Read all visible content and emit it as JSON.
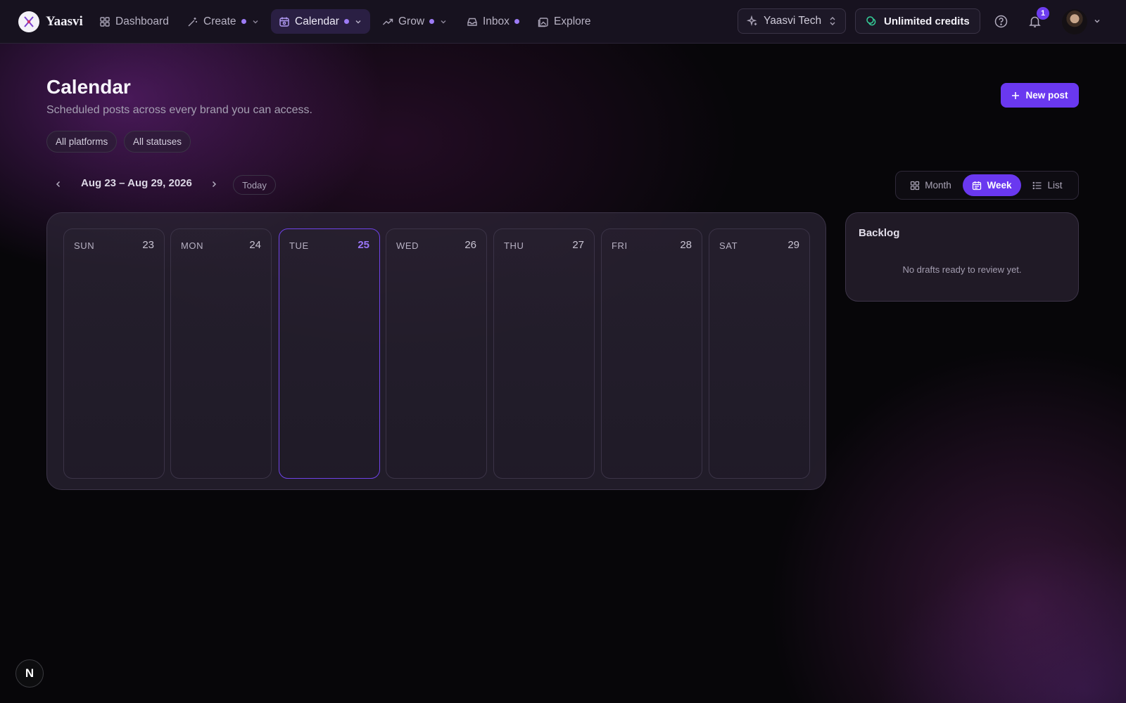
{
  "app": {
    "brand_name": "Yaasvi"
  },
  "nav": {
    "items": [
      {
        "label": "Dashboard",
        "icon": "dashboard-grid-icon",
        "dot": false,
        "dropdown": false,
        "active": false
      },
      {
        "label": "Create",
        "icon": "magic-wand-icon",
        "dot": true,
        "dropdown": true,
        "active": false
      },
      {
        "label": "Calendar",
        "icon": "calendar-icon",
        "dot": true,
        "dropdown": true,
        "active": true
      },
      {
        "label": "Grow",
        "icon": "trend-up-icon",
        "dot": true,
        "dropdown": true,
        "active": false
      },
      {
        "label": "Inbox",
        "icon": "inbox-tray-icon",
        "dot": true,
        "dropdown": false,
        "active": false
      },
      {
        "label": "Explore",
        "icon": "gallery-icon",
        "dot": false,
        "dropdown": false,
        "active": false
      }
    ]
  },
  "header_right": {
    "workspace": "Yaasvi Tech",
    "credits": "Unlimited credits",
    "notification_count": "1"
  },
  "page": {
    "title": "Calendar",
    "subtitle": "Scheduled posts across every brand you can access.",
    "new_post_label": "New post"
  },
  "filters": {
    "platforms": "All platforms",
    "statuses": "All statuses"
  },
  "toolbar": {
    "range_label": "Aug 23 – Aug 29, 2026",
    "today_label": "Today",
    "views": [
      {
        "label": "Month",
        "icon": "grid-icon",
        "active": false
      },
      {
        "label": "Week",
        "icon": "calendar-icon",
        "active": true
      },
      {
        "label": "List",
        "icon": "list-icon",
        "active": false
      }
    ]
  },
  "week": {
    "days": [
      {
        "name": "SUN",
        "num": "23",
        "today": false
      },
      {
        "name": "MON",
        "num": "24",
        "today": false
      },
      {
        "name": "TUE",
        "num": "25",
        "today": true
      },
      {
        "name": "WED",
        "num": "26",
        "today": false
      },
      {
        "name": "THU",
        "num": "27",
        "today": false
      },
      {
        "name": "FRI",
        "num": "28",
        "today": false
      },
      {
        "name": "SAT",
        "num": "29",
        "today": false
      }
    ]
  },
  "backlog": {
    "title": "Backlog",
    "empty_text": "No drafts ready to review yet."
  },
  "dev_badge": {
    "letter": "N"
  },
  "colors": {
    "accent": "#6a38f0",
    "accent_text": "#9a76f7",
    "topbar_bg": "#17121f",
    "credits_icon": "#35d09a"
  }
}
